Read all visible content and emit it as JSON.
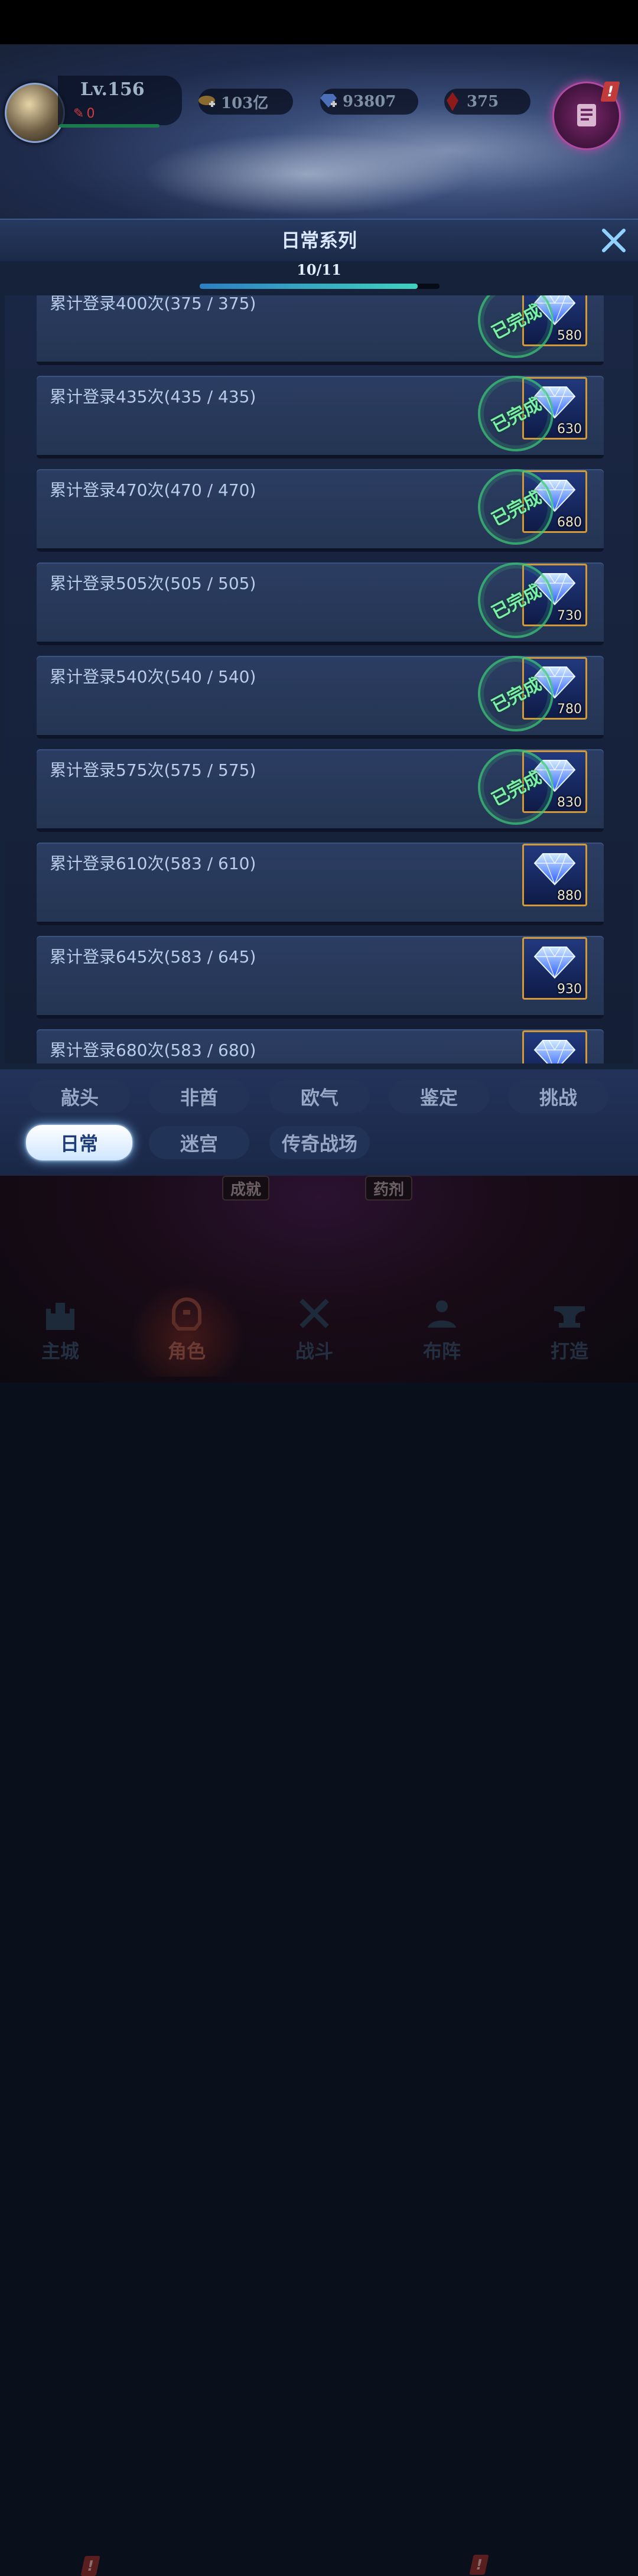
{
  "hud": {
    "level": "Lv.156",
    "power_value": "0",
    "gold": "103亿",
    "diamonds": "93807",
    "crystals": "375",
    "quest_alert": "!"
  },
  "panel": {
    "title": "日常系列",
    "progress_label": "10/11",
    "progress_fraction": 0.91
  },
  "tasks": [
    {
      "title": "累计登录400次(375 / 375)",
      "reward": "580",
      "completed": true
    },
    {
      "title": "累计登录435次(435 / 435)",
      "reward": "630",
      "completed": true
    },
    {
      "title": "累计登录470次(470 / 470)",
      "reward": "680",
      "completed": true
    },
    {
      "title": "累计登录505次(505 / 505)",
      "reward": "730",
      "completed": true
    },
    {
      "title": "累计登录540次(540 / 540)",
      "reward": "780",
      "completed": true
    },
    {
      "title": "累计登录575次(575 / 575)",
      "reward": "830",
      "completed": true
    },
    {
      "title": "累计登录610次(583 / 610)",
      "reward": "880",
      "completed": false
    },
    {
      "title": "累计登录645次(583 / 645)",
      "reward": "930",
      "completed": false
    },
    {
      "title": "累计登录680次(583 / 680)",
      "reward": "",
      "completed": false
    }
  ],
  "completed_stamp": "已完成",
  "tabs_row1": [
    "敲头",
    "非酋",
    "欧气",
    "鉴定",
    "挑战"
  ],
  "tabs_row2": [
    "日常",
    "迷宫",
    "传奇战场"
  ],
  "active_tab": "日常",
  "background_labels": {
    "achievements": "成就",
    "potions": "药剂"
  },
  "bottom_nav": [
    {
      "label": "主城",
      "icon": "castle-icon",
      "alert": true
    },
    {
      "label": "角色",
      "icon": "helmet-icon",
      "active": true
    },
    {
      "label": "战斗",
      "icon": "crossed-swords-icon"
    },
    {
      "label": "布阵",
      "icon": "formation-icon",
      "alert": true
    },
    {
      "label": "打造",
      "icon": "anvil-icon"
    }
  ],
  "colors": {
    "accent": "#3fd3c0",
    "reward_border": "#d19a37",
    "stamp": "#7cf0a8",
    "alert": "#c23b3b"
  }
}
